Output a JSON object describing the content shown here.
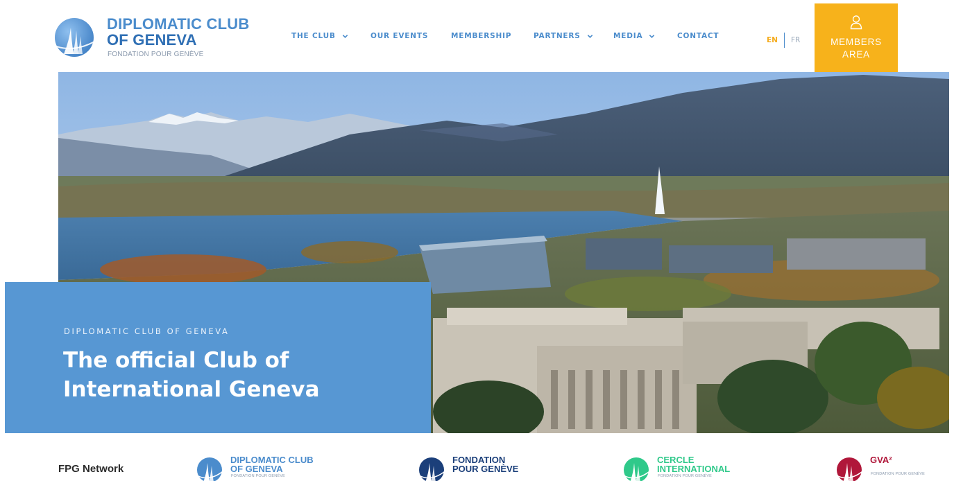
{
  "brand": {
    "line1": "DIPLOMATIC CLUB",
    "line2": "OF GENEVA",
    "tagline": "FONDATION POUR GENÈVE",
    "color_primary": "#4b8ccc",
    "color_dark": "#2f6fb4"
  },
  "nav": {
    "items": [
      {
        "label": "THE CLUB",
        "has_dropdown": true,
        "icon": "chevron-down-icon"
      },
      {
        "label": "OUR EVENTS",
        "has_dropdown": false
      },
      {
        "label": "MEMBERSHIP",
        "has_dropdown": false
      },
      {
        "label": "PARTNERS",
        "has_dropdown": true,
        "icon": "chevron-down-icon"
      },
      {
        "label": "MEDIA",
        "has_dropdown": true,
        "icon": "chevron-down-icon"
      },
      {
        "label": "CONTACT",
        "has_dropdown": false
      }
    ]
  },
  "language": {
    "active": "EN",
    "other": "FR",
    "active_color": "#f5ac1e"
  },
  "members_area": {
    "line1": "MEMBERS",
    "line2": "AREA",
    "icon": "user-icon",
    "bg_color": "#f7b21b"
  },
  "hero": {
    "image_subject": "aerial view of Geneva with lake, Jet d'Eau and Palais des Nations",
    "eyebrow": "DIPLOMATIC CLUB OF GENEVA",
    "title_line1": "The official Club of",
    "title_line2": "International Geneva",
    "panel_color": "#5797d3"
  },
  "network": {
    "label": "FPG Network",
    "logos": [
      {
        "line1": "DIPLOMATIC CLUB",
        "line2": "OF GENEVA",
        "small": "FONDATION POUR GENÈVE",
        "color": "#4b8ccc"
      },
      {
        "line1": "FONDATION",
        "line2": "POUR GENÈVE",
        "small": "",
        "color": "#1b3f7a"
      },
      {
        "line1": "CERCLE",
        "line2": "INTERNATIONAL",
        "small": "FONDATION POUR GENÈVE",
        "color": "#2fc98a"
      },
      {
        "line1": "GVA²",
        "line2": "",
        "small": "FONDATION POUR GENÈVE",
        "color": "#b0173a"
      }
    ]
  }
}
